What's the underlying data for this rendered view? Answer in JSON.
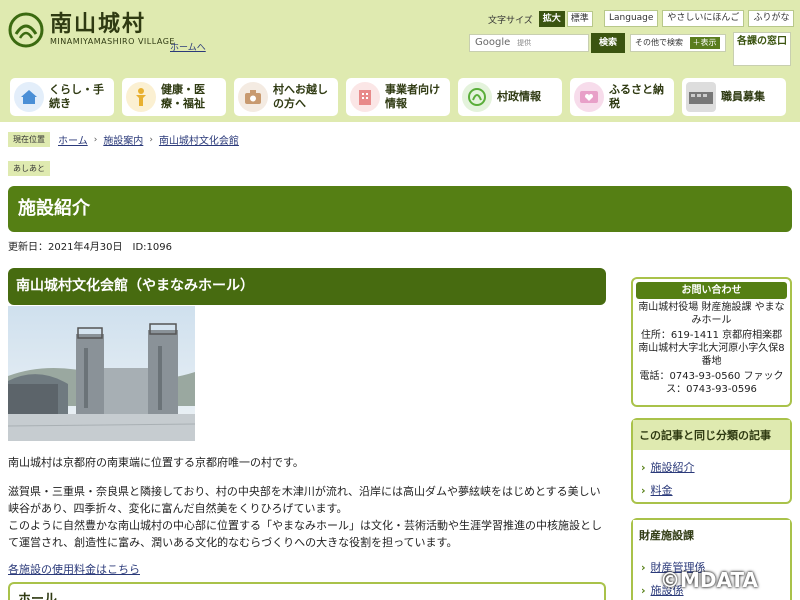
{
  "header": {
    "logo_title": "南山城村",
    "logo_sub": "MINAMIYAMASHIRO VILLAGE",
    "home_link": "ホームへ",
    "font_size_label": "文字サイズ",
    "font_large": "拡大",
    "font_standard": "標準",
    "lang_buttons": [
      "Language",
      "やさしいにほんご",
      "ふりがな"
    ],
    "search_google": "Google",
    "search_provided": "提供",
    "search_button": "検索",
    "other_search": "その他で検索",
    "other_search_show": "＋表示",
    "kakushu": "各課の窓口"
  },
  "nav": [
    {
      "label": "くらし・手続き",
      "icon": "house-icon",
      "color": "#4a8fd6"
    },
    {
      "label": "健康・医療・福祉",
      "icon": "person-icon",
      "color": "#e8b030"
    },
    {
      "label": "村へお越しの方へ",
      "icon": "camera-icon",
      "color": "#c89a70"
    },
    {
      "label": "事業者向け情報",
      "icon": "building-icon",
      "color": "#e88a8a"
    },
    {
      "label": "村政情報",
      "icon": "leaf-icon",
      "color": "#5aae3a"
    },
    {
      "label": "ふるさと納税",
      "icon": "furusato-icon",
      "color": "#e8a0c8"
    },
    {
      "label": "職員募集",
      "icon": "staff-photo-icon",
      "color": "#666666"
    }
  ],
  "breadcrumb": {
    "tag": "現在位置",
    "items": [
      "ホーム",
      "施設案内",
      "南山城村文化会館"
    ],
    "ashiato": "あしあと"
  },
  "page": {
    "title": "施設紹介",
    "updated": "更新日：2021年4月30日　ID:1096",
    "subtitle": "南山城村文化会館（やまなみホール）",
    "para1": "南山城村は京都府の南東端に位置する京都府唯一の村です。",
    "para2": "滋賀県・三重県・奈良県と隣接しており、村の中央部を木津川が流れ、沿岸には高山ダムや夢絃峡をはじめとする美しい峡谷があり、四季折々、変化に富んだ自然美をくりひろげています。",
    "para3": "このように自然豊かな南山城村の中心部に位置する「やまなみホール」は文化・芸術活動や生涯学習推進の中核施設として運営され、創造性に富み、潤いある文化的なむらづくりへの大きな役割を担っています。",
    "fee_link": "各施設の使用料金はこちら",
    "hall_heading": "ホール"
  },
  "sidebar": {
    "contact_head": "お問い合わせ",
    "contact_org": "南山城村役場 財産施設課 やまなみホール",
    "contact_address": "住所：619-1411 京都府相楽郡南山城村大字北大河原小字久保8番地",
    "contact_phone": "電話：0743-93-0560 ファックス：0743-93-0596",
    "related_head": "この記事と同じ分類の記事",
    "related_items": [
      "施設紹介",
      "料金"
    ],
    "zaisan_head": "財産施設課",
    "zaisan_items": [
      "財産管理係",
      "施設係"
    ]
  },
  "watermark": "©MDATA",
  "colors": {
    "accent": "#557f14",
    "header_bg": "#dfeab0",
    "border": "#a9c24a"
  }
}
